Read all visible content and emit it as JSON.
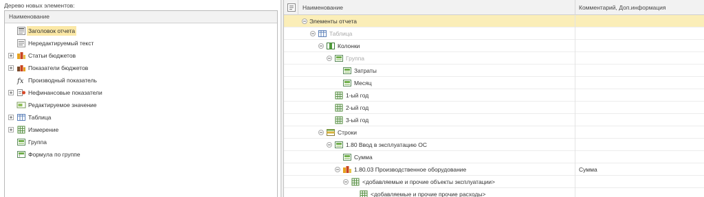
{
  "left": {
    "caption": "Дерево новых элементов:",
    "column_header": "Наименование",
    "items": [
      {
        "label": "Заголовок отчета",
        "icon": "report-header-icon",
        "expandable": false,
        "selected": true
      },
      {
        "label": "Нередактируемый текст",
        "icon": "static-text-icon",
        "expandable": false,
        "selected": false
      },
      {
        "label": "Статьи бюджетов",
        "icon": "budget-items-icon",
        "expandable": true,
        "selected": false
      },
      {
        "label": "Показатели бюджетов",
        "icon": "budget-indicators-icon",
        "expandable": true,
        "selected": false
      },
      {
        "label": "Производный показатель",
        "icon": "formula-fx-icon",
        "expandable": false,
        "selected": false
      },
      {
        "label": "Нефинансовые показатели",
        "icon": "nonfinancial-indicators-icon",
        "expandable": true,
        "selected": false
      },
      {
        "label": "Редактируемое значение",
        "icon": "editable-value-icon",
        "expandable": false,
        "selected": false
      },
      {
        "label": "Таблица",
        "icon": "table-icon",
        "expandable": true,
        "selected": false
      },
      {
        "label": "Измерение",
        "icon": "dimension-grid-icon",
        "expandable": true,
        "selected": false
      },
      {
        "label": "Группа",
        "icon": "group-icon",
        "expandable": false,
        "selected": false
      },
      {
        "label": "Формула по группе",
        "icon": "group-formula-icon",
        "expandable": false,
        "selected": false
      }
    ]
  },
  "right": {
    "header": {
      "settings_icon": "table-settings-icon",
      "name_col": "Наименование",
      "comment_col": "Комментарий, Доп.информация"
    },
    "rows": [
      {
        "label": "Элементы отчета",
        "level": 0,
        "expander": "minus",
        "icon": "",
        "dim": false,
        "selected": true,
        "comment": ""
      },
      {
        "label": "Таблица",
        "level": 1,
        "expander": "minus",
        "icon": "table-icon",
        "dim": true,
        "selected": false,
        "comment": ""
      },
      {
        "label": "Колонки",
        "level": 2,
        "expander": "minus",
        "icon": "columns-icon",
        "dim": false,
        "selected": false,
        "comment": ""
      },
      {
        "label": "Группа",
        "level": 3,
        "expander": "minus",
        "icon": "group-icon",
        "dim": true,
        "selected": false,
        "comment": ""
      },
      {
        "label": "Затраты",
        "level": 4,
        "expander": "",
        "icon": "group-icon",
        "dim": false,
        "selected": false,
        "comment": ""
      },
      {
        "label": "Месяц",
        "level": 4,
        "expander": "",
        "icon": "group-icon",
        "dim": false,
        "selected": false,
        "comment": ""
      },
      {
        "label": "1-ый год",
        "level": 3,
        "expander": "",
        "icon": "dimension-grid-icon",
        "dim": false,
        "selected": false,
        "comment": ""
      },
      {
        "label": "2-ый год",
        "level": 3,
        "expander": "",
        "icon": "dimension-grid-icon",
        "dim": false,
        "selected": false,
        "comment": ""
      },
      {
        "label": "3-ый год",
        "level": 3,
        "expander": "",
        "icon": "dimension-grid-icon",
        "dim": false,
        "selected": false,
        "comment": ""
      },
      {
        "label": "Строки",
        "level": 2,
        "expander": "minus",
        "icon": "rows-icon",
        "dim": false,
        "selected": false,
        "comment": ""
      },
      {
        "label": "1.80 Ввод в эксплуатацию ОС",
        "level": 3,
        "expander": "minus",
        "icon": "group-icon",
        "dim": false,
        "selected": false,
        "comment": ""
      },
      {
        "label": "Сумма",
        "level": 4,
        "expander": "",
        "icon": "group-icon",
        "dim": false,
        "selected": false,
        "comment": ""
      },
      {
        "label": "1.80.03 Производственное оборудование",
        "level": 4,
        "expander": "minus",
        "icon": "budget-items-icon",
        "dim": false,
        "selected": false,
        "comment": "Сумма"
      },
      {
        "label": "<добавляемые и прочие объекты эксплуатации>",
        "level": 5,
        "expander": "minus",
        "icon": "dimension-grid-icon",
        "dim": false,
        "selected": false,
        "comment": ""
      },
      {
        "label": "<добавляемые и прочие прочие расходы>",
        "level": 6,
        "expander": "",
        "icon": "dimension-grid-icon",
        "dim": false,
        "selected": false,
        "comment": ""
      }
    ]
  },
  "colors": {
    "selection": "#fbe8a6",
    "selection_row": "#fbeeb8",
    "header_bg": "#f2f2f2",
    "border": "#b9b9b9",
    "dim_text": "#a9a9a9"
  }
}
